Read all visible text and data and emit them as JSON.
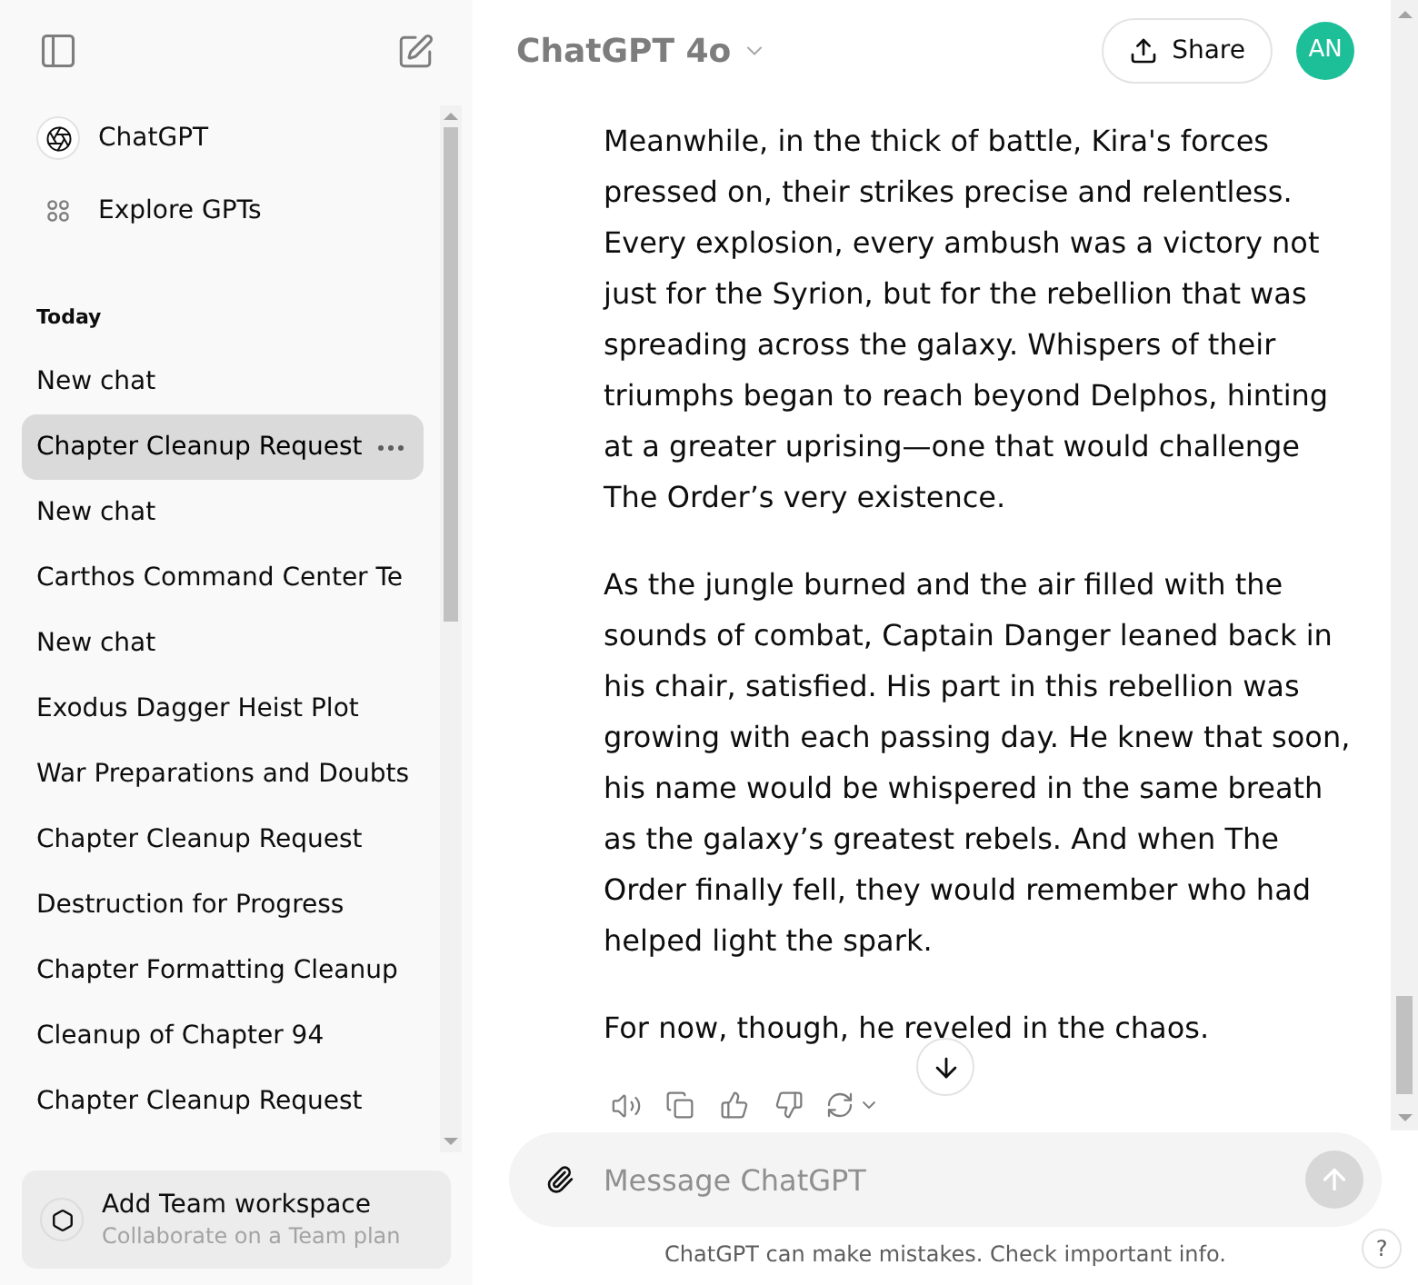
{
  "sidebar": {
    "nav": [
      {
        "kind": "logo",
        "label": "ChatGPT"
      },
      {
        "kind": "grid",
        "label": "Explore GPTs"
      }
    ],
    "section": "Today",
    "chats": [
      {
        "title": "New chat",
        "selected": false
      },
      {
        "title": "Chapter Cleanup Request",
        "selected": true
      },
      {
        "title": "New chat",
        "selected": false
      },
      {
        "title": "Carthos Command Center Te",
        "selected": false
      },
      {
        "title": "New chat",
        "selected": false
      },
      {
        "title": "Exodus Dagger Heist Plot",
        "selected": false
      },
      {
        "title": "War Preparations and Doubts",
        "selected": false
      },
      {
        "title": "Chapter Cleanup Request",
        "selected": false
      },
      {
        "title": "Destruction for Progress",
        "selected": false
      },
      {
        "title": "Chapter Formatting Cleanup",
        "selected": false
      },
      {
        "title": "Cleanup of Chapter 94",
        "selected": false
      },
      {
        "title": "Chapter Cleanup Request",
        "selected": false
      }
    ],
    "workspace": {
      "title": "Add Team workspace",
      "subtitle": "Collaborate on a Team plan"
    }
  },
  "header": {
    "model": "ChatGPT 4o",
    "share": "Share",
    "avatar": "AN"
  },
  "message": {
    "paragraphs": [
      "Meanwhile, in the thick of battle, Kira's forces pressed on, their strikes precise and relentless. Every explosion, every ambush was a victory not just for the Syrion, but for the rebellion that was spreading across the galaxy. Whispers of their triumphs began to reach beyond Delphos, hinting at a greater uprising—one that would challenge The Order’s very existence.",
      "As the jungle burned and the air filled with the sounds of combat, Captain Danger leaned back in his chair, satisfied. His part in this rebellion was growing with each passing day. He knew that soon, his name would be whispered in the same breath as the galaxy’s greatest rebels. And when The Order finally fell, they would remember who had helped light the spark.",
      "For now, though, he reveled in the chaos."
    ]
  },
  "composer": {
    "placeholder": "Message ChatGPT"
  },
  "footer": {
    "note": "ChatGPT can make mistakes. Check important info.",
    "help": "?"
  }
}
